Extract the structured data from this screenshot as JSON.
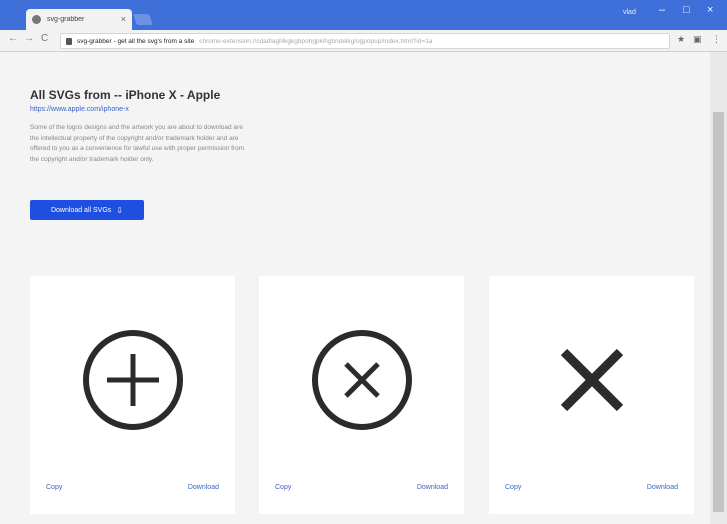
{
  "browser": {
    "tab_title": "svg-grabber",
    "tab_close": "×",
    "window_user": "vlad",
    "window_controls": {
      "minimize": "–",
      "maximize": "□",
      "close": "×"
    },
    "url_host": "svg-grabber - get all the svg's from a site",
    "url_path": "chrome-extension://cdadlaghlkgkgbpohgpkihgbndelkg/ogpopup/index.html?id=1a",
    "nav": {
      "back": "←",
      "forward": "→",
      "reload": "C"
    },
    "toolbar_icons": {
      "star": "★",
      "extension": "▣",
      "menu": "⋮"
    }
  },
  "page": {
    "heading": "All SVGs from -- iPhone X - Apple",
    "source_url": "https://www.apple.com/iphone-x",
    "disclaimer": "Some of the logos designs and the artwork you are about to download are the intellectual property of the copyright and/or trademark holder and are offered to you as a convenience for lawful use with proper permission from the copyright and/or trademark holder only.",
    "download_all_label": "Download all SVGs",
    "download_all_icon": "download-icon"
  },
  "cards": [
    {
      "icon": "circle-plus-icon",
      "copy_label": "Copy",
      "download_label": "Download"
    },
    {
      "icon": "circle-x-icon",
      "copy_label": "Copy",
      "download_label": "Download"
    },
    {
      "icon": "x-icon",
      "copy_label": "Copy",
      "download_label": "Download"
    }
  ],
  "colors": {
    "titlebar": "#3f6fd8",
    "primary_button": "#1f4fe0",
    "link": "#3b63c4",
    "icon_stroke": "#2b2b2b"
  }
}
